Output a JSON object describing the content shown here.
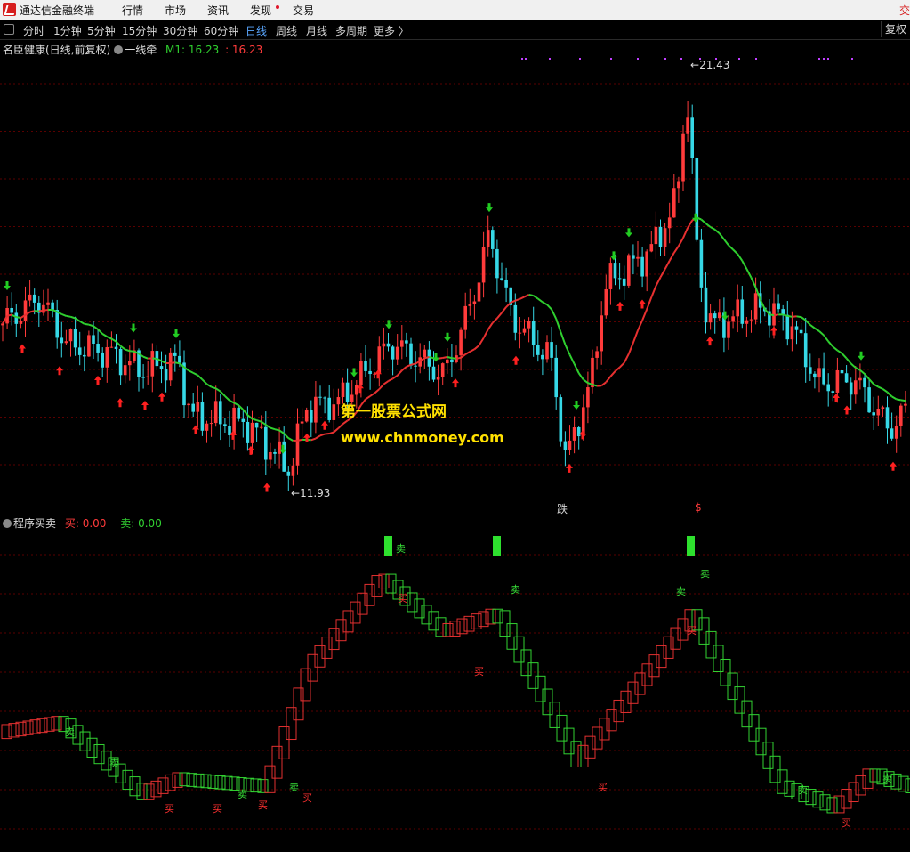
{
  "menu": {
    "app_title": "通达信金融终端",
    "items": [
      "行情",
      "市场",
      "资讯",
      "发现",
      "交易"
    ],
    "right_cut": "交"
  },
  "periods": {
    "items": [
      "分时",
      "1分钟",
      "5分钟",
      "15分钟",
      "30分钟",
      "60分钟",
      "日线",
      "周线",
      "月线",
      "多周期",
      "更多 〉"
    ],
    "active_index": 6,
    "fuquan": "复权"
  },
  "main_panel": {
    "stock_title": "名臣健康(日线,前复权)",
    "indicator_name": "一线牵",
    "m1_label": "M1: 16.23",
    "m1_value2": ": 16.23",
    "high_label": "21.43",
    "low_label": "11.93",
    "marker_die": "跌",
    "marker_s": "$",
    "watermark_cn": "第一股票公式网",
    "watermark_url": "www.chnmoney.com"
  },
  "sub_panel": {
    "indicator_name": "程序买卖",
    "buy_label": "买: 0.00",
    "sell_label": "卖: 0.00",
    "buy_char": "买",
    "sell_char": "卖"
  },
  "colors": {
    "up": "#ff3b3b",
    "down": "#36d8e6",
    "ma_up": "#e83030",
    "ma_down": "#2fcf2f",
    "osc_up": "#e23030",
    "osc_down": "#32d232",
    "grid": "#5a0000",
    "text_yellow": "#ffe000"
  },
  "chart_data": {
    "type": "candlestick",
    "high": 21.43,
    "low": 11.93,
    "m1": 16.23,
    "osc_keypoints": [
      [
        0,
        0.36
      ],
      [
        70,
        0.4
      ],
      [
        160,
        0.12
      ],
      [
        200,
        0.18
      ],
      [
        300,
        0.15
      ],
      [
        350,
        0.62
      ],
      [
        430,
        0.96
      ],
      [
        500,
        0.75
      ],
      [
        560,
        0.82
      ],
      [
        650,
        0.25
      ],
      [
        780,
        0.82
      ],
      [
        880,
        0.15
      ],
      [
        940,
        0.07
      ],
      [
        980,
        0.2
      ],
      [
        1023,
        0.15
      ]
    ]
  }
}
